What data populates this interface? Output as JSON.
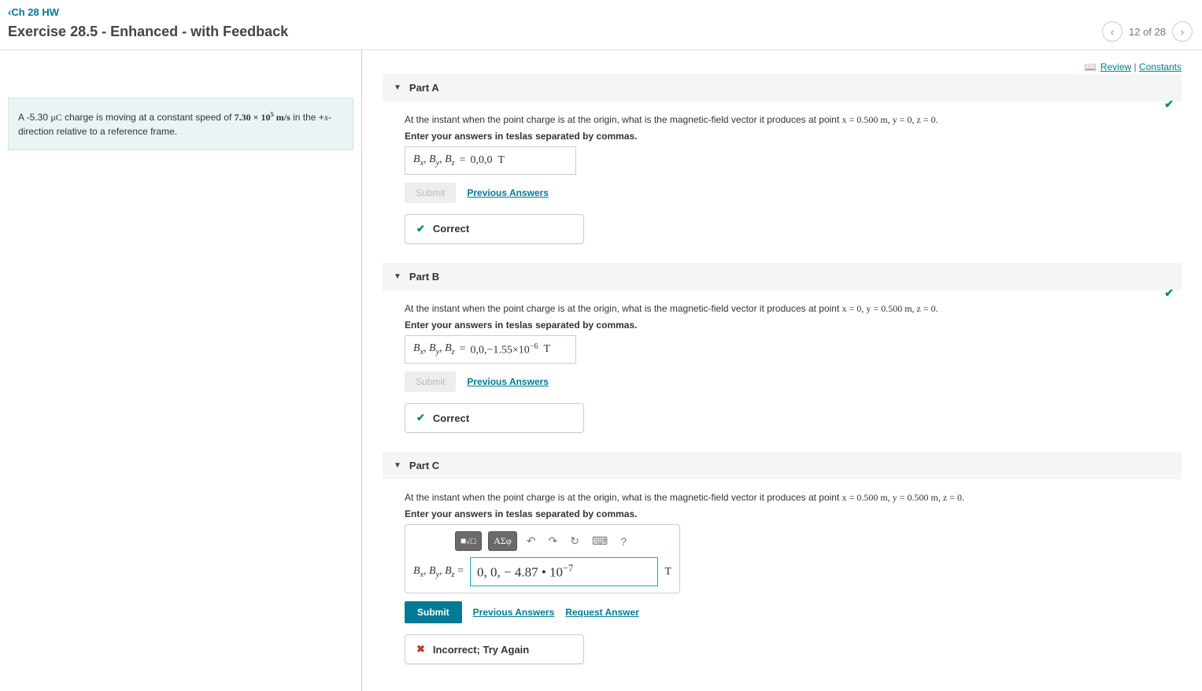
{
  "back_link": "Ch 28 HW",
  "page_title": "Exercise 28.5 - Enhanced - with Feedback",
  "pager": "12 of 28",
  "top_right": {
    "review": "Review",
    "constants": "Constants"
  },
  "problem": {
    "pre": "A -5.30 ",
    "u1": "μC",
    "mid1": " charge is moving at a constant speed of ",
    "speed_a": "7.30 × 10",
    "speed_exp": "5",
    "unit": " m/s",
    "mid2": " in the +",
    "x": "x",
    "post": "-direction relative to a reference frame."
  },
  "parts": {
    "a": {
      "label": "Part A",
      "prompt_pre": "At the instant when the point charge is at the origin, what is the magnetic-field vector it produces at point ",
      "coords": "x = 0.500 m, y = 0, z = 0",
      "instr": "Enter your answers in teslas separated by commas.",
      "lhs": "Bₓ, Bᵧ, B_z",
      "value": "0,0,0",
      "unit": "T",
      "submit": "Submit",
      "prev": "Previous Answers",
      "feedback": "Correct"
    },
    "b": {
      "label": "Part B",
      "prompt_pre": "At the instant when the point charge is at the origin, what is the magnetic-field vector it produces at point ",
      "coords": "x = 0, y = 0.500 m, z = 0",
      "instr": "Enter your answers in teslas separated by commas.",
      "value": "0,0,−1.55×10",
      "value_exp": "−6",
      "unit": "T",
      "submit": "Submit",
      "prev": "Previous Answers",
      "feedback": "Correct"
    },
    "c": {
      "label": "Part C",
      "prompt_pre": "At the instant when the point charge is at the origin, what is the magnetic-field vector it produces at point ",
      "coords": "x = 0.500 m, y = 0.500 m, z = 0",
      "instr": "Enter your answers in teslas separated by commas.",
      "input_value": "0, 0, − 4.87 • 10",
      "input_exp": "−7",
      "unit": "T",
      "submit": "Submit",
      "prev": "Previous Answers",
      "req": "Request Answer",
      "feedback": "Incorrect; Try Again",
      "tb_sigma": "ΑΣφ"
    }
  },
  "period": "."
}
